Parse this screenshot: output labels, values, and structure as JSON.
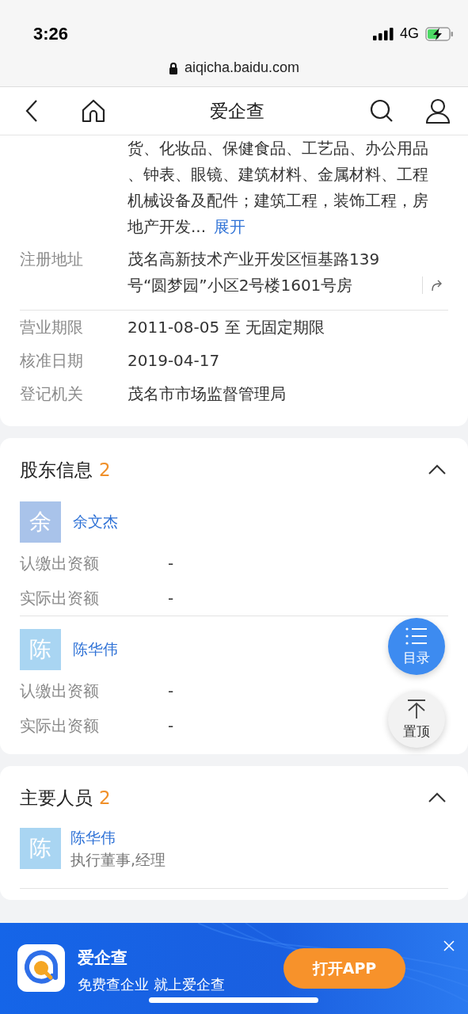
{
  "status_bar": {
    "time": "3:26",
    "network": "4G"
  },
  "address_bar": {
    "url": "aiqicha.baidu.com"
  },
  "nav": {
    "title": "爱企查"
  },
  "basic_info": {
    "scope_text": "货、化妆品、保健食品、工艺品、办公用品、钟表、眼镜、建筑材料、金属材料、工程机械设备及配件；建筑工程，装饰工程，房地产开发...",
    "expand_link": "展开",
    "fields": [
      {
        "kind": "address",
        "label": "注册地址",
        "value": "茂名高新技术产业开发区恒基路139号“圆梦园”小区2号楼1601号房"
      },
      {
        "kind": "divider"
      },
      {
        "kind": "plain",
        "label": "营业期限",
        "value": "2011-08-05 至 无固定期限"
      },
      {
        "kind": "plain",
        "label": "核准日期",
        "value": "2019-04-17"
      },
      {
        "kind": "plain",
        "label": "登记机关",
        "value": "茂名市市场监督管理局"
      }
    ]
  },
  "shareholders": {
    "title": "股东信息",
    "count": "2",
    "expanded": true,
    "items": [
      {
        "avatar": "余",
        "color": "#a9c3ea",
        "name": "余文杰",
        "fields": [
          {
            "label": "认缴出资额",
            "value": "-"
          },
          {
            "label": "实际出资额",
            "value": "-"
          }
        ]
      },
      {
        "avatar": "陈",
        "color": "#a9d5f2",
        "name": "陈华伟",
        "fields": [
          {
            "label": "认缴出资额",
            "value": "-"
          },
          {
            "label": "实际出资额",
            "value": "-"
          }
        ]
      }
    ]
  },
  "key_personnel": {
    "title": "主要人员",
    "count": "2",
    "expanded": true,
    "items": [
      {
        "avatar": "陈",
        "color": "#a9d5f2",
        "name": "陈华伟",
        "role": "执行董事,经理"
      }
    ]
  },
  "floating_buttons": [
    {
      "kind": "catalog",
      "label": "目录"
    },
    {
      "kind": "top",
      "label": "置顶"
    }
  ],
  "app_banner": {
    "app_name": "爱企查",
    "slogan": "免费查企业 就上爱企查",
    "button": "打开APP"
  }
}
